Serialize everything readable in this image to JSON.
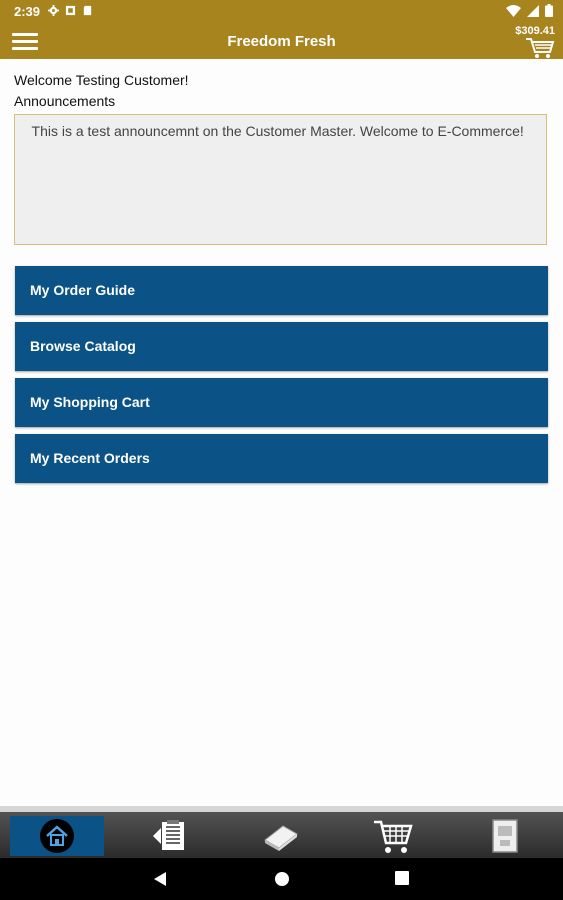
{
  "status_bar": {
    "time": "2:39",
    "icons": [
      "settings-icon",
      "notification-icon",
      "sd-card-icon",
      "wifi-icon",
      "signal-icon",
      "battery-icon"
    ]
  },
  "app_bar": {
    "title": "Freedom Fresh",
    "cart_total": "$309.41",
    "accent_color": "#a8841f"
  },
  "main": {
    "welcome": "Welcome Testing Customer!",
    "announcements_label": "Announcements",
    "announcement_text": "  This is a test announcemnt on the Customer Master.  Welcome to E-Commerce!",
    "buttons": [
      {
        "label": "My Order Guide"
      },
      {
        "label": "Browse Catalog"
      },
      {
        "label": "My Shopping Cart"
      },
      {
        "label": "My Recent Orders"
      }
    ],
    "button_color": "#0b5286"
  },
  "bottom_tabs": [
    {
      "name": "home",
      "icon": "home-icon",
      "active": true
    },
    {
      "name": "order-guide",
      "icon": "order-guide-icon",
      "active": false
    },
    {
      "name": "catalog",
      "icon": "catalog-book-icon",
      "active": false
    },
    {
      "name": "cart",
      "icon": "shopping-cart-icon",
      "active": false
    },
    {
      "name": "account",
      "icon": "account-icon",
      "active": false
    }
  ],
  "system_nav": [
    "back-icon",
    "home-circle-icon",
    "recents-icon"
  ]
}
